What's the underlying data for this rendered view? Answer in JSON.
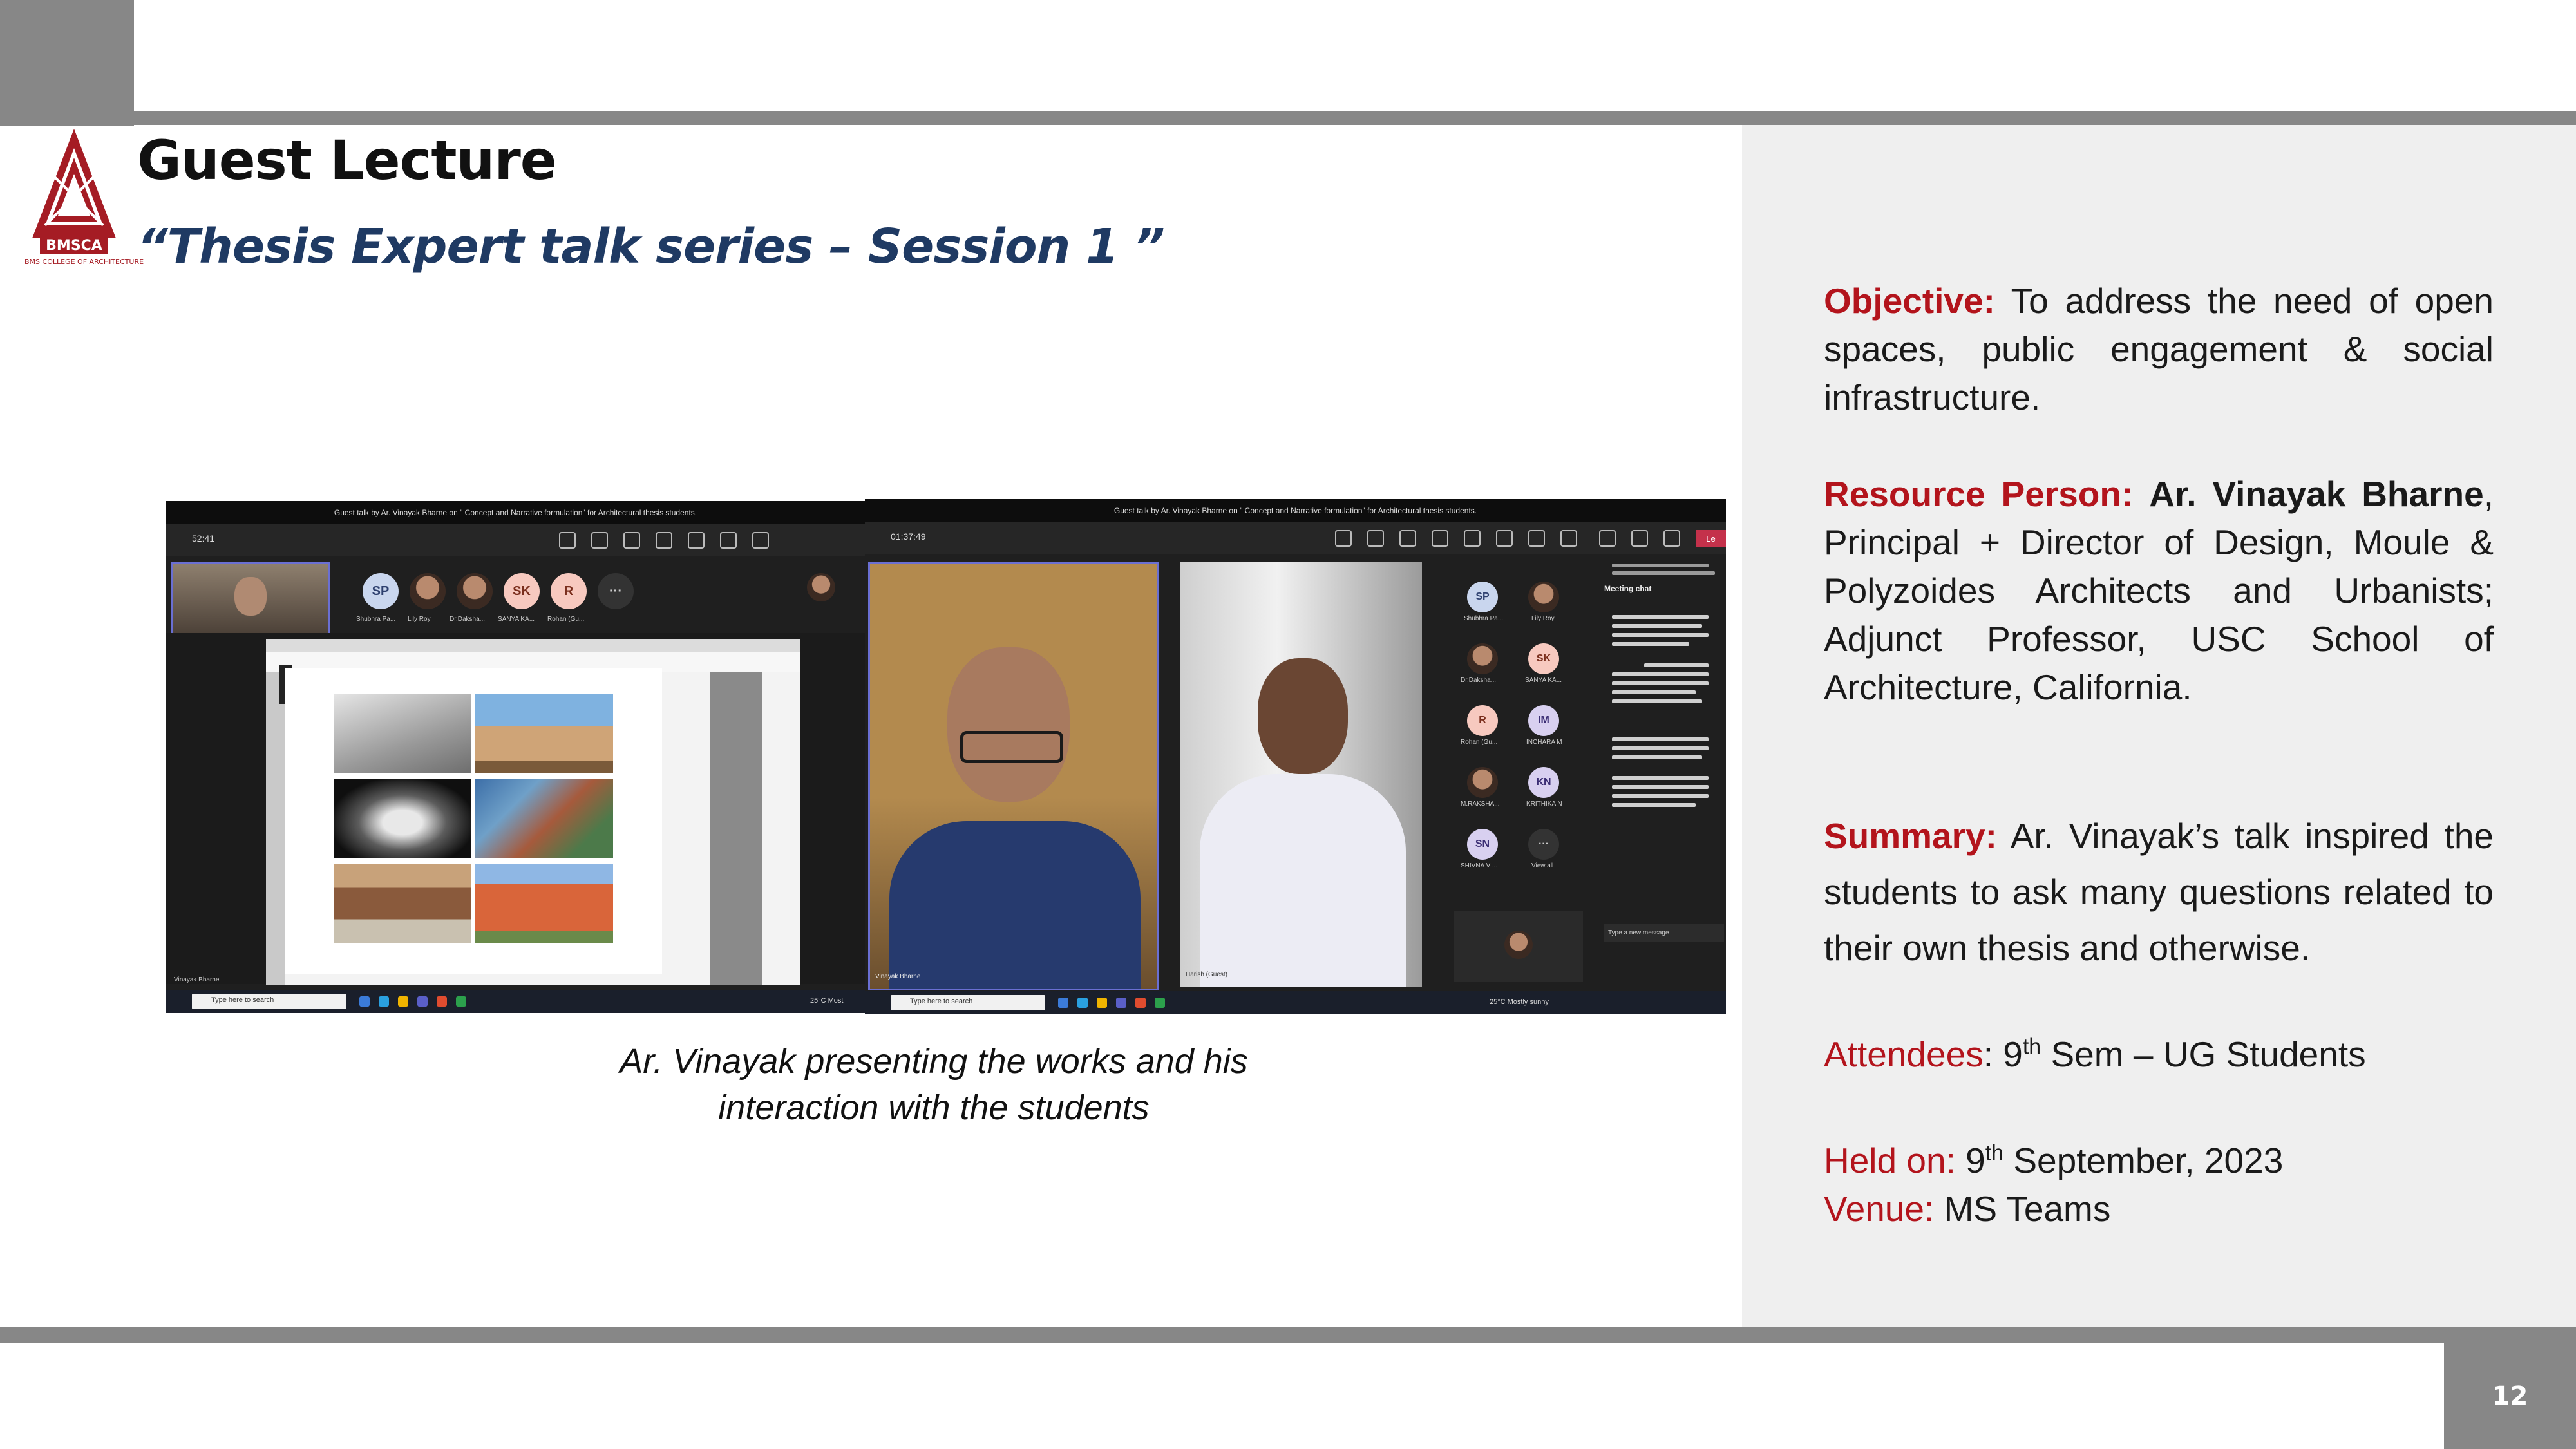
{
  "slide": {
    "title": "Guest Lecture",
    "subtitle": "“Thesis Expert talk series – Session 1 ”",
    "page_number": "12",
    "logo_text": "BMSCA",
    "logo_caption": "BMS COLLEGE OF ARCHITECTURE"
  },
  "screenshots": {
    "left": {
      "meeting_title": "Guest talk by Ar. Vinayak Bharne on \" Concept and Narrative formulation\" for Architectural thesis students.",
      "timer": "52:41",
      "participants": [
        {
          "initials": "SP",
          "name": "Shubhra Pa..."
        },
        {
          "initials": "",
          "name": "Lily Roy"
        },
        {
          "initials": "",
          "name": "Dr.Daksha..."
        },
        {
          "initials": "SK",
          "name": "SANYA KA..."
        },
        {
          "initials": "R",
          "name": "Rohan (Gu..."
        }
      ],
      "presenter": "Vinayak Bharne",
      "taskbar_search": "Type here to search",
      "weather": "25°C  Most"
    },
    "right": {
      "meeting_title": "Guest talk by Ar. Vinayak Bharne on \" Concept and Narrative formulation\" for Architectural thesis students.",
      "timer": "01:37:49",
      "tile_left_name": "Vinayak Bharne",
      "tile_right_name": "Harish (Guest)",
      "people": [
        {
          "initials": "SP",
          "name": "Shubhra Pa..."
        },
        {
          "initials": "",
          "name": "Lily Roy"
        },
        {
          "initials": "",
          "name": "Dr.Daksha..."
        },
        {
          "initials": "SK",
          "name": "SANYA KA..."
        },
        {
          "initials": "R",
          "name": "Rohan (Gu..."
        },
        {
          "initials": "IM",
          "name": "INCHARA M"
        },
        {
          "initials": "",
          "name": "M.RAKSHA..."
        },
        {
          "initials": "KN",
          "name": "KRITHIKA N"
        },
        {
          "initials": "SN",
          "name": "SHIVNA V ..."
        },
        {
          "initials": "···",
          "name": "View all"
        }
      ],
      "chat_title": "Meeting chat",
      "chat_input": "Type a new message",
      "taskbar_search": "Type here to search",
      "weather": "25°C  Mostly sunny",
      "leave_label": "Le"
    }
  },
  "caption": {
    "line1": "Ar. Vinayak presenting the works and his",
    "line2": "interaction with the students"
  },
  "details": {
    "objective_label": "Objective:",
    "objective_text": " To address the need of open spaces, public engagement & social infrastructure.",
    "resource_label": "Resource Person:",
    "resource_name": "Ar. Vinayak Bharne",
    "resource_text": ", Principal + Director of Design, Moule & Polyzoides Architects and Urbanists; Adjunct Professor, USC School of Architecture, California.",
    "summary_label": "Summary:",
    "summary_text": " Ar. Vinayak’s talk inspired the students to ask many questions related to their own thesis and otherwise.",
    "attendees_label": "Attendees",
    "attendees_prefix": ": 9",
    "attendees_sup": "th",
    "attendees_suffix": " Sem – UG Students",
    "held_label": "Held on:",
    "held_prefix": " 9",
    "held_sup": "th",
    "held_suffix": "  September, 2023",
    "venue_label": "Venue:",
    "venue_text": " MS Teams"
  },
  "colors": {
    "frame_gray": "#878787",
    "panel_gray": "#efefef",
    "title_black": "#111111",
    "subtitle_navy": "#1f3a63",
    "label_red": "#b3141c"
  }
}
